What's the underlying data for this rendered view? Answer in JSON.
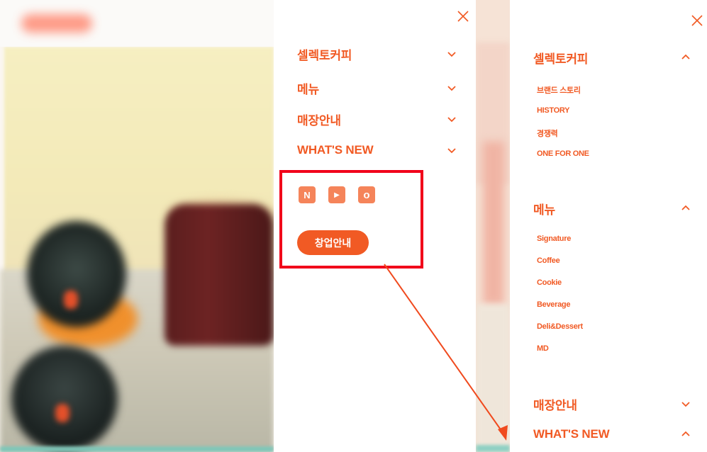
{
  "colors": {
    "accent": "#f15a24",
    "sns_bg": "#f5845a",
    "annotation": "#f1001a"
  },
  "panel_left": {
    "close_icon": "close-icon",
    "menu": [
      {
        "label": "셀렉토커피",
        "chevron": "chevron-down-icon"
      },
      {
        "label": "메뉴",
        "chevron": "chevron-down-icon"
      },
      {
        "label": "매장안내",
        "chevron": "chevron-down-icon"
      },
      {
        "label": "WHAT'S NEW",
        "chevron": "chevron-down-icon"
      }
    ],
    "sns": [
      {
        "icon": "naver-blog-icon",
        "glyph": "N"
      },
      {
        "icon": "youtube-icon",
        "glyph": "▶"
      },
      {
        "icon": "instagram-icon",
        "glyph": "o"
      }
    ],
    "franchise_button": "창업안내"
  },
  "panel_right": {
    "close_icon": "close-icon",
    "sections": [
      {
        "label": "셀렉토커피",
        "chevron": "chevron-up-icon",
        "items": [
          "브랜드 스토리",
          "HISTORY",
          "경쟁력",
          "ONE FOR ONE"
        ]
      },
      {
        "label": "메뉴",
        "chevron": "chevron-up-icon",
        "items": [
          "Signature",
          "Coffee",
          "Cookie",
          "Beverage",
          "Deli&Dessert",
          "MD"
        ]
      },
      {
        "label": "매장안내",
        "chevron": "chevron-down-icon",
        "items": []
      },
      {
        "label": "WHAT'S NEW",
        "chevron": "chevron-up-icon",
        "items": []
      }
    ]
  }
}
